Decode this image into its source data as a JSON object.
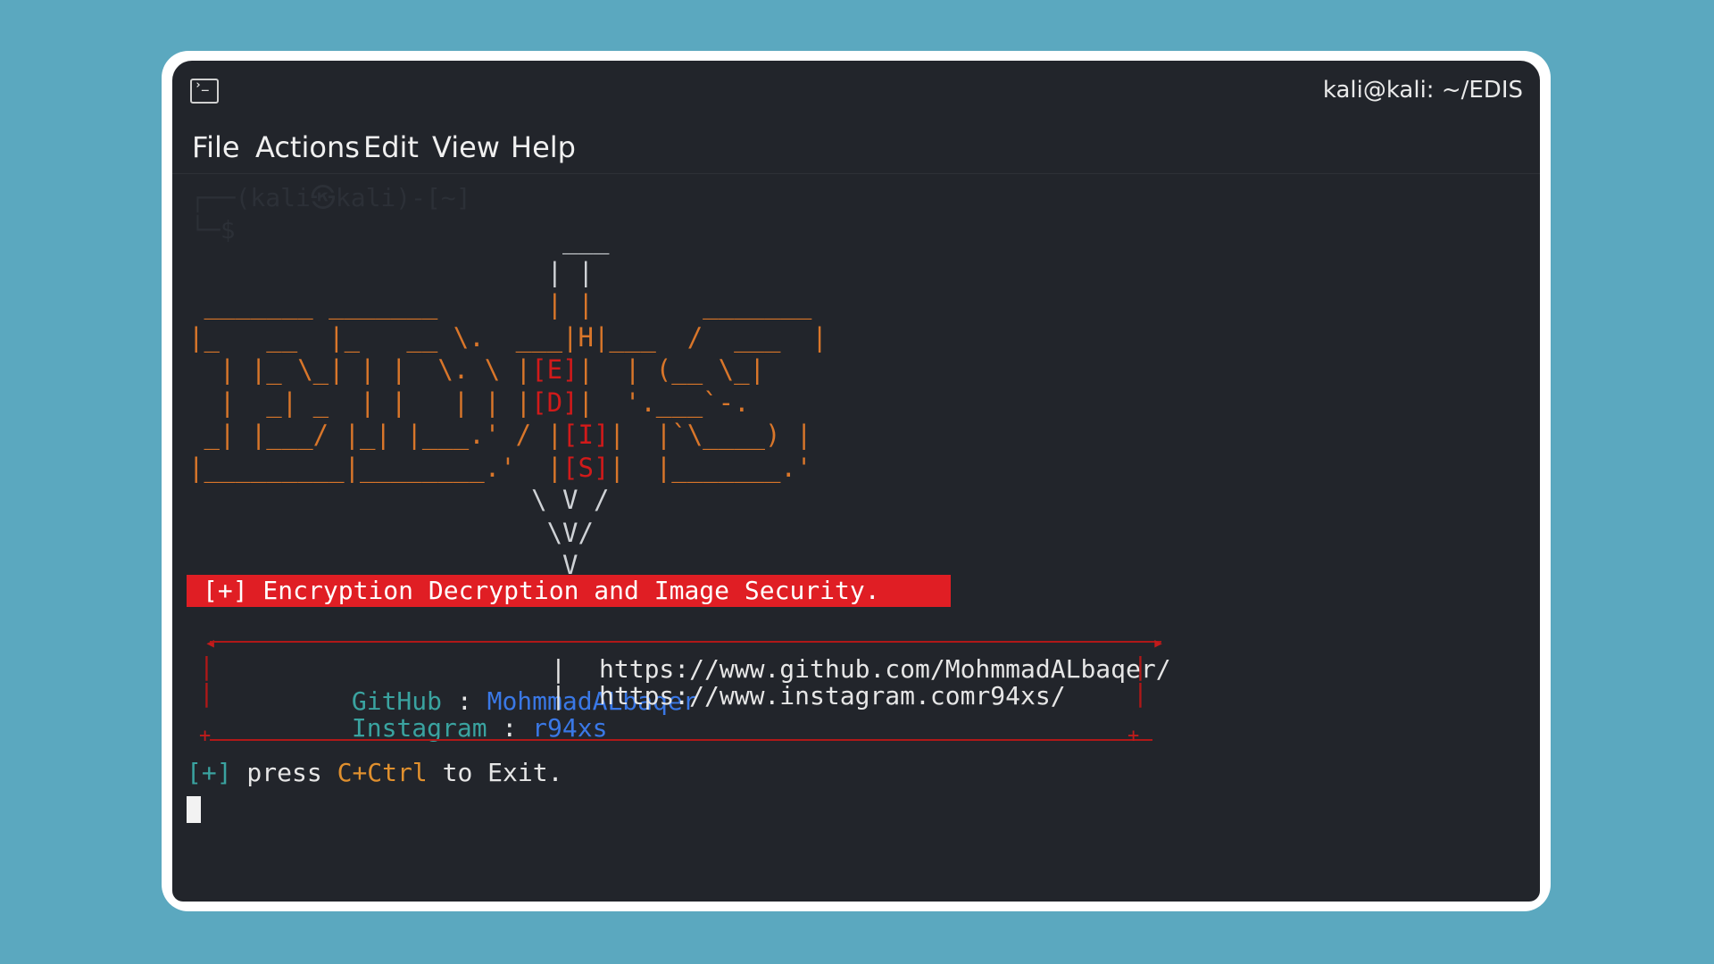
{
  "window": {
    "title": "kali@kali: ~/EDIS",
    "icon": "terminal-icon"
  },
  "menu": [
    "File",
    "Actions",
    "Edit",
    "View",
    "Help"
  ],
  "ghost_prompt": {
    "line1": "┌──(kali㉿kali)-[~]",
    "line2": "└─$"
  },
  "ascii": {
    "row0": "                        ___",
    "row1": "                       | |",
    "row2": " _______ _______       | |       _______",
    "row3": "|_   __  |_   __ \\.  ___|H|___  /  ___  |",
    "row4a": "  | |_ \\_| | |  \\. \\ |",
    "row4b": "[E]",
    "row4c": "|  | (__ \\_|",
    "row5a": "  |  _| _  | |   | | |",
    "row5b": "[D]",
    "row5c": "|  '.___`-.",
    "row6a": " _| |___/ |_| |___.' / |",
    "row6b": "[I]",
    "row6c": "|  |`\\____) |",
    "row7a": "|_________|________.'  |",
    "row7b": "[S]",
    "row7c": "|  |_______.'",
    "row8": "                      \\ V /",
    "row9": "                       \\V/",
    "row10": "                        V"
  },
  "banner": "[+] Encryption Decryption and Image Security.",
  "links": [
    {
      "label": "GitHub",
      "sep": " : ",
      "value": "MohmmadALbaqer",
      "url": "https://www.github.com/MohmmadALbaqer/"
    },
    {
      "label": "Instagram",
      "sep": " : ",
      "value": "r94xs",
      "url": "https://www.instagram.comr94xs/"
    }
  ],
  "footer": {
    "prefix": "[+]",
    "text1": " press ",
    "key": "C+Ctrl",
    "text2": " to Exit."
  },
  "colors": {
    "background": "#5ba8bf",
    "terminal": "#22252b",
    "banner": "#e01e24",
    "accent_orange": "#d9762a",
    "accent_red": "#d11a1a",
    "link_label": "#3aa3a0",
    "link_value": "#3a78e6"
  }
}
